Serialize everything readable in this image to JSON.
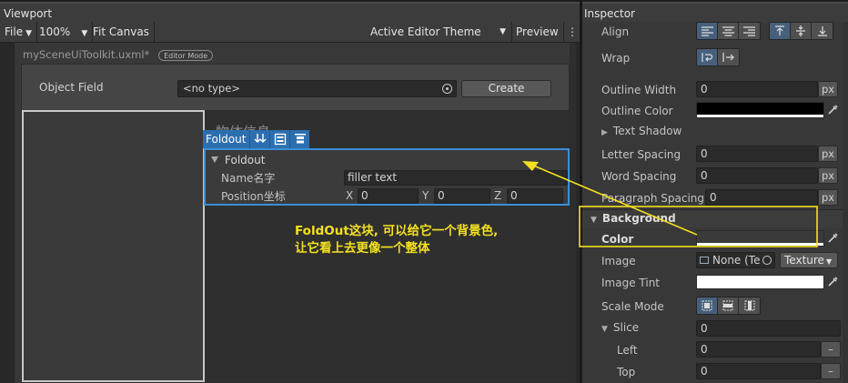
{
  "viewport": {
    "tab": "Viewport",
    "toolbar": {
      "file": "File",
      "zoom": "100%",
      "fit_canvas": "Fit Canvas",
      "theme": "Active Editor Theme",
      "preview": "Preview"
    },
    "doc_title": "mySceneUiToolkit.uxml*",
    "editor_badge": "Editor Mode",
    "object_field": {
      "label": "Object Field",
      "value": "<no type>",
      "button": "Create"
    },
    "obscured_heading": "物体信息",
    "selected_tag": "Foldout",
    "foldout": {
      "title": "Foldout",
      "name_label": "Name名字",
      "name_value": "filler text",
      "position_label": "Position坐标",
      "x_label": "X",
      "x_value": "0",
      "y_label": "Y",
      "y_value": "0",
      "z_label": "Z",
      "z_value": "0"
    },
    "annotation": {
      "line1": "FoldOut这块, 可以给它一个背景色,",
      "line2": "让它看上去更像一个整体",
      "color": "#f4e020"
    }
  },
  "inspector": {
    "tab": "Inspector",
    "align_label": "Align",
    "wrap_label": "Wrap",
    "outline_width": {
      "label": "Outline Width",
      "value": "0",
      "unit": "px"
    },
    "outline_color_label": "Outline Color",
    "text_shadow_label": "Text Shadow",
    "letter_spacing": {
      "label": "Letter Spacing",
      "value": "0",
      "unit": "px"
    },
    "word_spacing": {
      "label": "Word Spacing",
      "value": "0",
      "unit": "px"
    },
    "paragraph_spacing": {
      "label": "Paragraph Spacing",
      "value": "0",
      "unit": "px"
    },
    "background_header": "Background",
    "color_label": "Color",
    "image": {
      "label": "Image",
      "value": "None (Te",
      "type": "Texture"
    },
    "image_tint_label": "Image Tint",
    "scale_mode_label": "Scale Mode",
    "slice": {
      "label": "Slice",
      "value": "0"
    },
    "left": {
      "label": "Left",
      "value": "0"
    },
    "top": {
      "label": "Top",
      "value": "0"
    },
    "accent_color": "#46607c",
    "highlight_color": "#f4e020"
  }
}
